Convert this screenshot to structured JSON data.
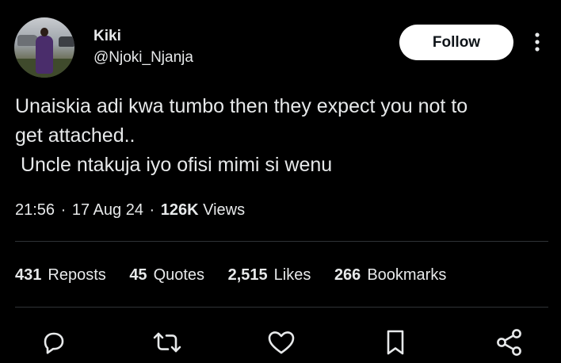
{
  "user": {
    "display_name": "Kiki",
    "handle": "@Njoki_Njanja"
  },
  "header": {
    "follow_label": "Follow",
    "more_icon": "more-vertical-icon"
  },
  "tweet": {
    "text": "Unaiskia adi kwa tumbo then they expect you not to\nget attached..\n Uncle ntakuja iyo ofisi mimi si wenu",
    "time": "21:56",
    "date": "17 Aug 24",
    "views_count": "126K",
    "views_label": "Views"
  },
  "stats": {
    "reposts_count": "431",
    "reposts_label": "Reposts",
    "quotes_count": "45",
    "quotes_label": "Quotes",
    "likes_count": "2,515",
    "likes_label": "Likes",
    "bookmarks_count": "266",
    "bookmarks_label": "Bookmarks"
  },
  "actions": [
    {
      "icon": "reply-icon"
    },
    {
      "icon": "repost-icon"
    },
    {
      "icon": "like-icon"
    },
    {
      "icon": "bookmark-icon"
    },
    {
      "icon": "share-icon"
    }
  ],
  "colors": {
    "background": "#000000",
    "text": "#e7e9ea",
    "divider": "#2f3336",
    "icon": "#e7e9ea",
    "follow_bg": "#ffffff",
    "follow_text": "#0f1419"
  }
}
